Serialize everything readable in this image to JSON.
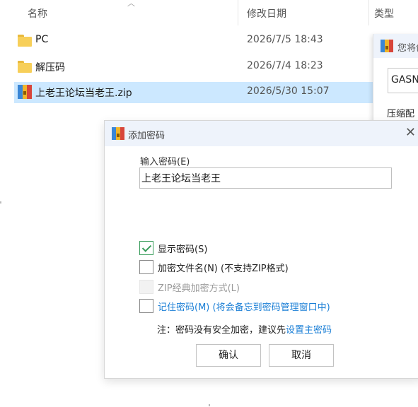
{
  "explorer": {
    "columns": {
      "name": "名称",
      "modified": "修改日期",
      "type": "类型"
    },
    "rows": [
      {
        "name": "PC",
        "date": "2026/7/5 18:43",
        "icon": "folder-icon"
      },
      {
        "name": "解压码",
        "date": "2026/7/4 18:23",
        "icon": "folder-icon"
      },
      {
        "name": "上老王论坛当老王.zip",
        "date": "2026/5/30 15:07",
        "icon": "zip-archive-icon"
      }
    ]
  },
  "background_window": {
    "title": "您将创",
    "field_value": "GASN",
    "label": "压缩配"
  },
  "dialog": {
    "title": "添加密码",
    "close_glyph": "✕",
    "password_label": "输入密码(E)",
    "password_value": "上老王论坛当老王",
    "options": {
      "show_password": "显示密码(S)",
      "encrypt_filenames": "加密文件名(N) (不支持ZIP格式)",
      "zip_classic": "ZIP经典加密方式(L)",
      "remember_password": "记住密码(M) (将会备忘到密码管理窗口中)"
    },
    "note_text": "注：密码没有安全加密，建议先",
    "note_link": "设置主密码",
    "ok_label": "确认",
    "cancel_label": "取消"
  },
  "colors": {
    "selection": "#cce8ff",
    "link": "#1b7fd6",
    "check": "#3a9d5c"
  }
}
